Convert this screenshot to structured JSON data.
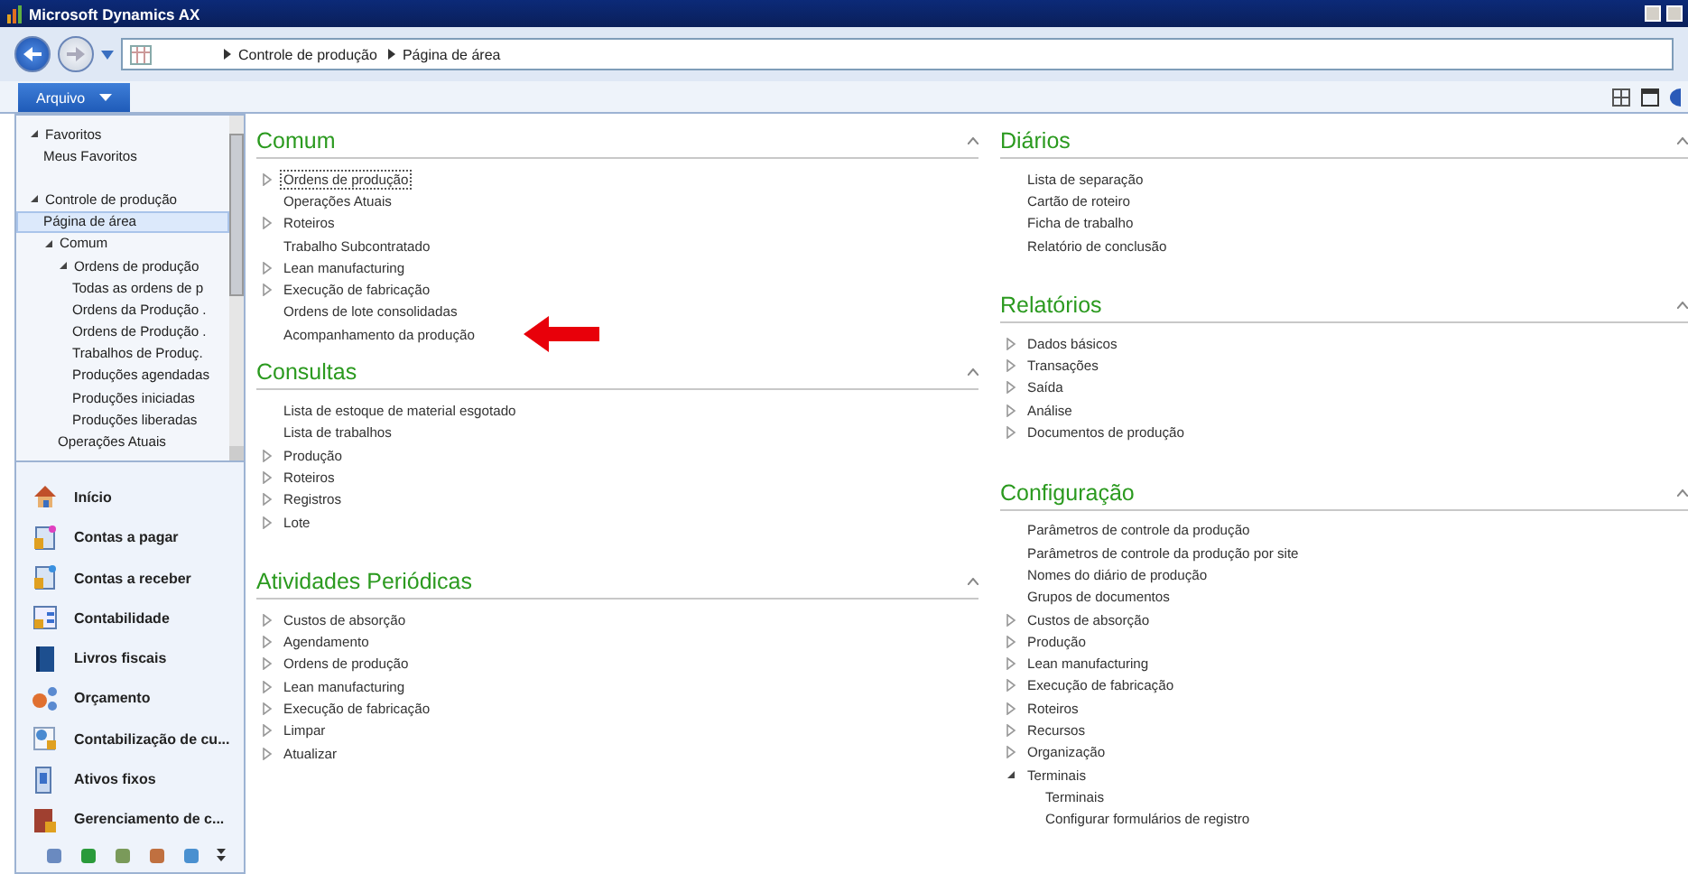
{
  "window": {
    "title": "Microsoft Dynamics AX"
  },
  "address": {
    "crumbs": [
      "Controle de produção",
      "Página de área"
    ]
  },
  "menu": {
    "label": "Arquivo"
  },
  "nav_tree": [
    {
      "label": "Favoritos",
      "expanded": true,
      "selected": false,
      "children": [
        {
          "label": "Meus Favoritos",
          "expanded": false,
          "selected": false
        }
      ]
    },
    {
      "label": "Controle de produção",
      "expanded": true,
      "selected": false,
      "children": [
        {
          "label": "Página de área",
          "expanded": false,
          "selected": true
        },
        {
          "label": "Comum",
          "expanded": true,
          "selected": false,
          "children": [
            {
              "label": "Ordens de produção",
              "expanded": true,
              "selected": false,
              "children": [
                {
                  "label": "Todas as ordens de p",
                  "expanded": false,
                  "selected": false
                },
                {
                  "label": "Ordens da Produção .",
                  "expanded": false,
                  "selected": false
                },
                {
                  "label": "Ordens de Produção .",
                  "expanded": false,
                  "selected": false
                },
                {
                  "label": "Trabalhos de Produç.",
                  "expanded": false,
                  "selected": false
                },
                {
                  "label": "Produções agendadas",
                  "expanded": false,
                  "selected": false
                },
                {
                  "label": "Produções iniciadas",
                  "expanded": false,
                  "selected": false
                },
                {
                  "label": "Produções liberadas",
                  "expanded": false,
                  "selected": false
                }
              ]
            },
            {
              "label": "Operações Atuais",
              "expanded": false,
              "selected": false
            }
          ]
        }
      ]
    }
  ],
  "modules": [
    {
      "label": "Início"
    },
    {
      "label": "Contas a pagar"
    },
    {
      "label": "Contas a receber"
    },
    {
      "label": "Contabilidade"
    },
    {
      "label": "Livros fiscais"
    },
    {
      "label": "Orçamento"
    },
    {
      "label": "Contabilização de cu..."
    },
    {
      "label": "Ativos fixos"
    },
    {
      "label": "Gerenciamento de c..."
    }
  ],
  "columns": [
    [
      {
        "title": "Comum",
        "items": [
          {
            "label": "Ordens de produção",
            "kind": "group",
            "expanded": false,
            "focused": true
          },
          {
            "label": "Operações Atuais",
            "kind": "link"
          },
          {
            "label": "Roteiros",
            "kind": "group",
            "expanded": false
          },
          {
            "label": "Trabalho Subcontratado",
            "kind": "link"
          },
          {
            "label": "Lean manufacturing",
            "kind": "group",
            "expanded": false
          },
          {
            "label": "Execução de fabricação",
            "kind": "group",
            "expanded": false
          },
          {
            "label": "Ordens de lote consolidadas",
            "kind": "link"
          },
          {
            "label": "Acompanhamento da produção",
            "kind": "link",
            "pointer": true
          }
        ]
      },
      {
        "title": "Consultas",
        "items": [
          {
            "label": "Lista de estoque de material esgotado",
            "kind": "link"
          },
          {
            "label": "Lista de trabalhos",
            "kind": "link"
          },
          {
            "label": "Produção",
            "kind": "group",
            "expanded": false
          },
          {
            "label": "Roteiros",
            "kind": "group",
            "expanded": false
          },
          {
            "label": "Registros",
            "kind": "group",
            "expanded": false
          },
          {
            "label": "Lote",
            "kind": "group",
            "expanded": false
          }
        ]
      },
      {
        "title": "Atividades Periódicas",
        "items": [
          {
            "label": "Custos de absorção",
            "kind": "group",
            "expanded": false
          },
          {
            "label": "Agendamento",
            "kind": "group",
            "expanded": false
          },
          {
            "label": "Ordens de produção",
            "kind": "group",
            "expanded": false
          },
          {
            "label": "Lean manufacturing",
            "kind": "group",
            "expanded": false
          },
          {
            "label": "Execução de fabricação",
            "kind": "group",
            "expanded": false
          },
          {
            "label": "Limpar",
            "kind": "group",
            "expanded": false
          },
          {
            "label": "Atualizar",
            "kind": "group",
            "expanded": false
          }
        ]
      }
    ],
    [
      {
        "title": "Diários",
        "items": [
          {
            "label": "Lista de separação",
            "kind": "link"
          },
          {
            "label": "Cartão de roteiro",
            "kind": "link"
          },
          {
            "label": "Ficha de trabalho",
            "kind": "link"
          },
          {
            "label": "Relatório de conclusão",
            "kind": "link"
          }
        ]
      },
      {
        "title": "Relatórios",
        "items": [
          {
            "label": "Dados básicos",
            "kind": "group",
            "expanded": false
          },
          {
            "label": "Transações",
            "kind": "group",
            "expanded": false
          },
          {
            "label": "Saída",
            "kind": "group",
            "expanded": false
          },
          {
            "label": "Análise",
            "kind": "group",
            "expanded": false
          },
          {
            "label": "Documentos de produção",
            "kind": "group",
            "expanded": false
          }
        ]
      },
      {
        "title": "Configuração",
        "items": [
          {
            "label": "Parâmetros de controle da produção",
            "kind": "link"
          },
          {
            "label": "Parâmetros de controle da produção por site",
            "kind": "link"
          },
          {
            "label": "Nomes do diário de produção",
            "kind": "link"
          },
          {
            "label": "Grupos de documentos",
            "kind": "link"
          },
          {
            "label": "Custos de absorção",
            "kind": "group",
            "expanded": false
          },
          {
            "label": "Produção",
            "kind": "group",
            "expanded": false
          },
          {
            "label": "Lean manufacturing",
            "kind": "group",
            "expanded": false
          },
          {
            "label": "Execução de fabricação",
            "kind": "group",
            "expanded": false
          },
          {
            "label": "Roteiros",
            "kind": "group",
            "expanded": false
          },
          {
            "label": "Recursos",
            "kind": "group",
            "expanded": false
          },
          {
            "label": "Organização",
            "kind": "group",
            "expanded": false
          },
          {
            "label": "Terminais",
            "kind": "group",
            "expanded": true,
            "children": [
              {
                "label": "Terminais",
                "kind": "link"
              },
              {
                "label": "Configurar formulários de registro",
                "kind": "link"
              }
            ]
          }
        ]
      }
    ]
  ]
}
